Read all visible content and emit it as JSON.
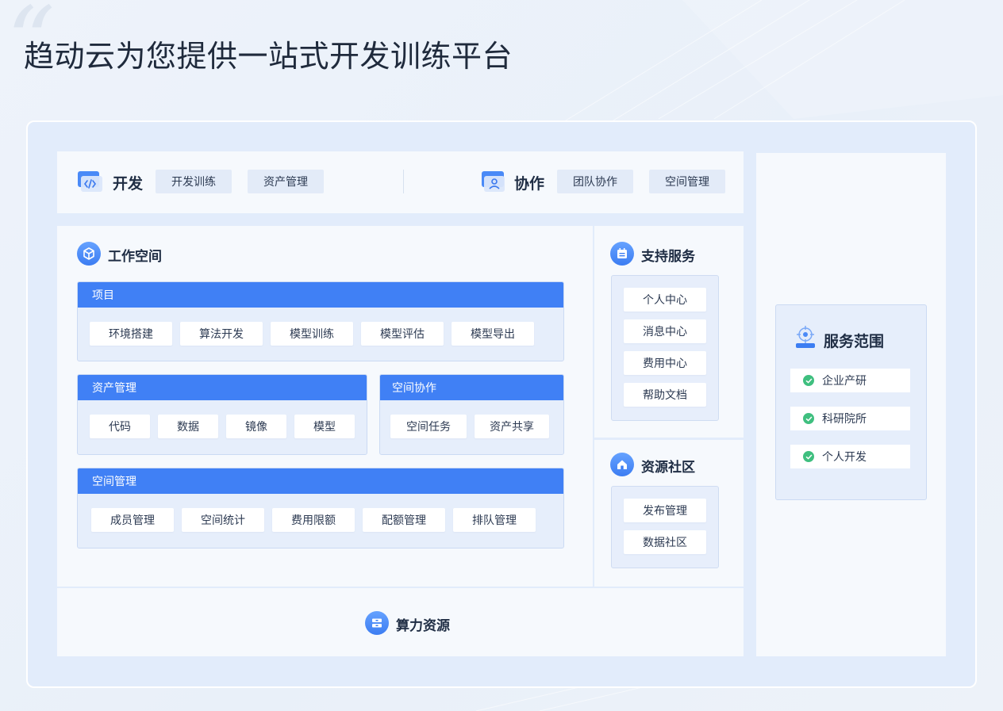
{
  "page": {
    "title": "趋动云为您提供一站式开发训练平台"
  },
  "top_bar": {
    "dev": {
      "label": "开发",
      "items": [
        "开发训练",
        "资产管理"
      ]
    },
    "collab": {
      "label": "协作",
      "items": [
        "团队协作",
        "空间管理"
      ]
    }
  },
  "workspace": {
    "title": "工作空间",
    "project": {
      "header": "项目",
      "items": [
        "环境搭建",
        "算法开发",
        "模型训练",
        "模型评估",
        "模型导出"
      ]
    },
    "assets": {
      "header": "资产管理",
      "items": [
        "代码",
        "数据",
        "镜像",
        "模型"
      ]
    },
    "space_collab": {
      "header": "空间协作",
      "items": [
        "空间任务",
        "资产共享"
      ]
    },
    "space_mgmt": {
      "header": "空间管理",
      "items": [
        "成员管理",
        "空间统计",
        "费用限额",
        "配额管理",
        "排队管理"
      ]
    }
  },
  "support": {
    "title": "支持服务",
    "items": [
      "个人中心",
      "消息中心",
      "费用中心",
      "帮助文档"
    ]
  },
  "community": {
    "title": "资源社区",
    "items": [
      "发布管理",
      "数据社区"
    ]
  },
  "compute": {
    "title": "算力资源"
  },
  "scope": {
    "title": "服务范围",
    "items": [
      "企业产研",
      "科研院所",
      "个人开发"
    ]
  },
  "colors": {
    "accent": "#4080f5",
    "frame": "#e2ecfb",
    "check": "#3fbf7f"
  },
  "icons": [
    "code-monitor-icon",
    "collab-monitor-icon",
    "cube-icon",
    "calendar-icon",
    "home-icon",
    "server-icon",
    "target-icon",
    "check-icon"
  ]
}
